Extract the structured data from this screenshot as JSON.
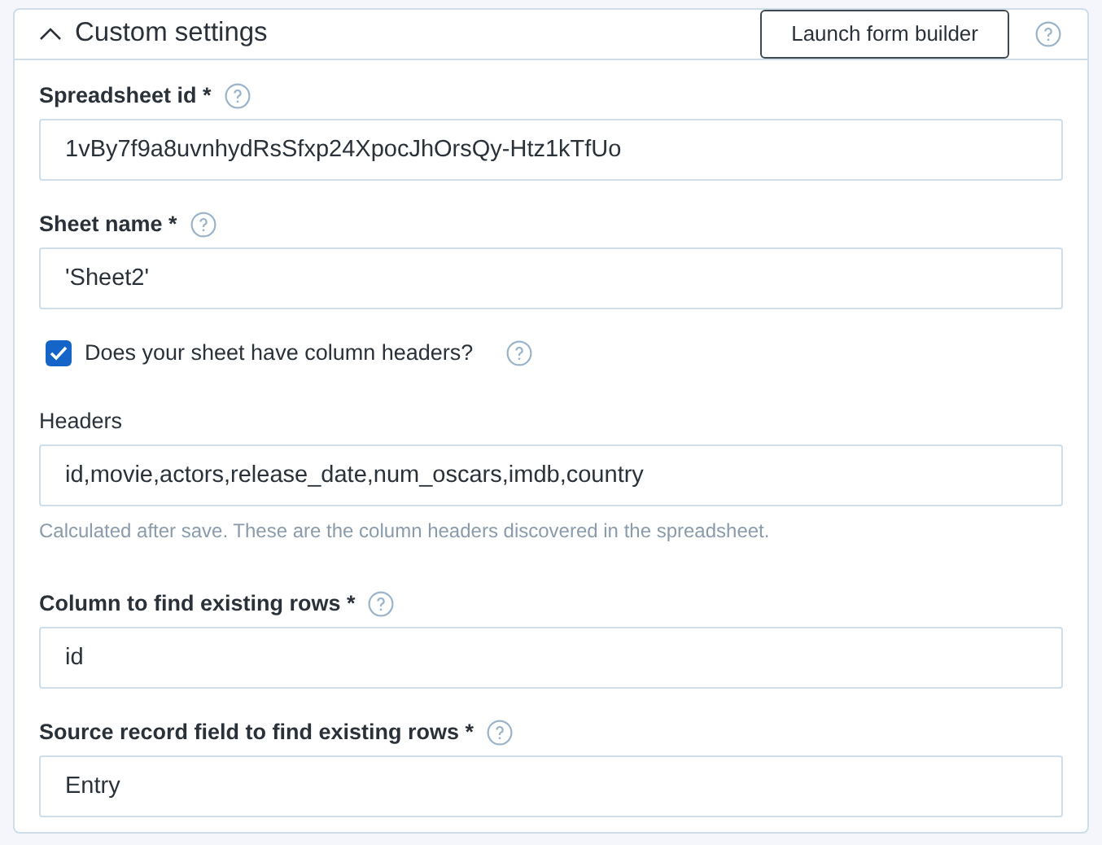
{
  "section": {
    "title": "Custom settings",
    "expanded": true,
    "button": "Launch form builder"
  },
  "items": [
    {
      "kind": "field",
      "label": "Spreadsheet id *",
      "label_bold": true,
      "has_help": true,
      "value": "1vBy7f9a8uvnhydRsSfxp24XpocJhOrsQy-Htz1kTfUo"
    },
    {
      "kind": "field",
      "label": "Sheet name *",
      "label_bold": true,
      "has_help": true,
      "value": "'Sheet2'"
    },
    {
      "kind": "checkbox",
      "label": "Does your sheet have column headers?",
      "checked": true,
      "has_help": true
    },
    {
      "kind": "field",
      "label": "Headers",
      "label_bold": false,
      "has_help": false,
      "value": "id,movie,actors,release_date,num_oscars,imdb,country",
      "hint": "Calculated after save. These are the column headers discovered in the spreadsheet."
    },
    {
      "kind": "field",
      "label": "Column to find existing rows *",
      "label_bold": true,
      "has_help": true,
      "value": "id"
    },
    {
      "kind": "field",
      "label": "Source record field to find existing rows *",
      "label_bold": true,
      "has_help": true,
      "value": "Entry"
    }
  ]
}
